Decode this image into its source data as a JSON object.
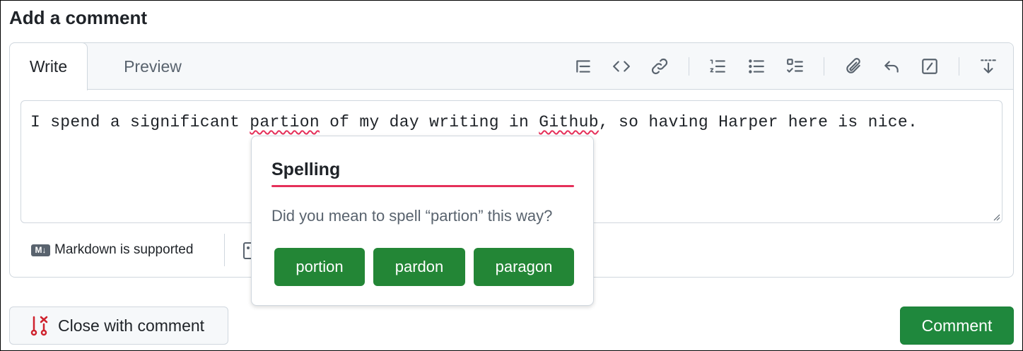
{
  "header": {
    "title": "Add a comment"
  },
  "tabs": [
    {
      "label": "Write"
    },
    {
      "label": "Preview"
    }
  ],
  "toolbar": {
    "icons": [
      "heading-icon",
      "code-icon",
      "link-icon",
      "ordered-list-icon",
      "unordered-list-icon",
      "task-list-icon",
      "attach-icon",
      "reply-icon",
      "slash-commands-icon",
      "collapse-toolbar-icon"
    ]
  },
  "textarea": {
    "before": "I spend a significant ",
    "word1": "partion",
    "middle": " of my day writing in ",
    "word2": "Github",
    "after": ", so having Harper here is nice."
  },
  "footer": {
    "markdown_label": "Markdown is supported",
    "markdown_badge": "M↓"
  },
  "spelling_popup": {
    "title": "Spelling",
    "message": "Did you mean to spell “partion” this way?",
    "suggestions": [
      "portion",
      "pardon",
      "paragon"
    ]
  },
  "actions": {
    "close_label": "Close with comment",
    "comment_label": "Comment"
  },
  "colors": {
    "accent_green": "#238636",
    "spelling_red": "#e5305a"
  }
}
